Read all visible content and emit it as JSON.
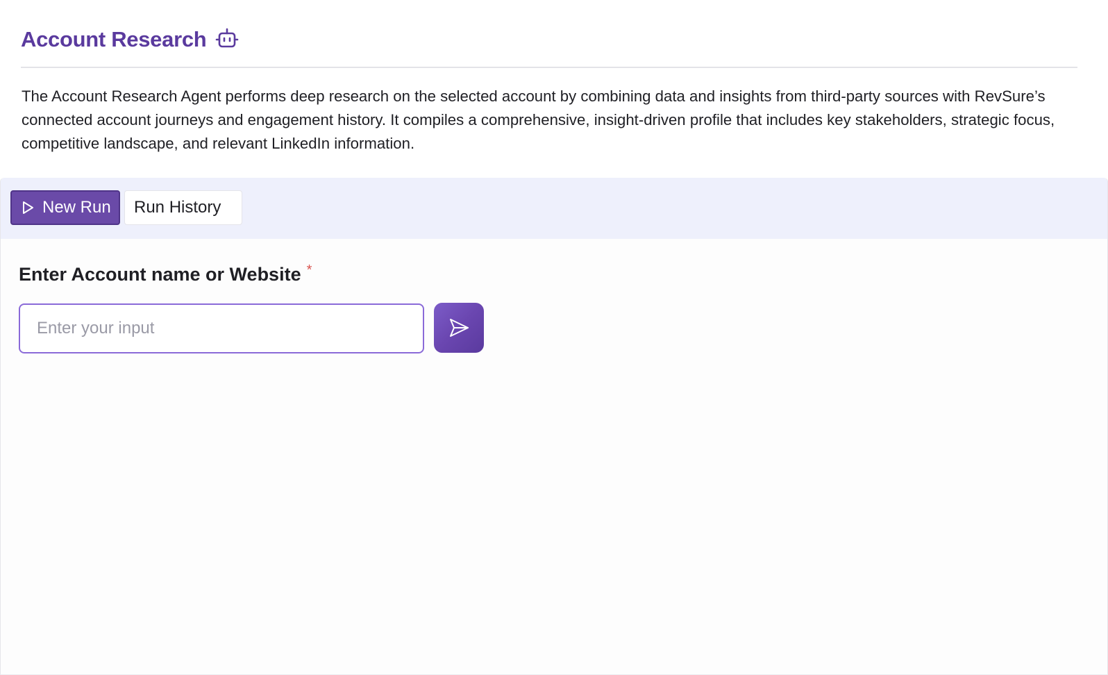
{
  "header": {
    "title": "Account Research",
    "title_icon": "robot-icon"
  },
  "description": "The Account Research Agent performs deep research on the selected account by combining data and insights from third-party sources with RevSure’s connected account journeys and engagement history. It compiles a comprehensive, insight-driven profile that includes key stakeholders, strategic focus, competitive landscape, and relevant LinkedIn information.",
  "tabs": {
    "new_run": {
      "label": "New Run",
      "icon": "play-icon",
      "active": true
    },
    "run_history": {
      "label": "Run History",
      "active": false
    }
  },
  "form": {
    "label": "Enter Account name or Website",
    "required_mark": "*",
    "input": {
      "value": "",
      "placeholder": "Enter your input"
    },
    "submit_icon": "send-icon"
  },
  "colors": {
    "brand": "#5a3a9e",
    "tab_active_bg": "#6a4aa8",
    "tabbar_bg": "#eef0fc",
    "input_border": "#8a6ad8",
    "required": "#d9534f"
  }
}
